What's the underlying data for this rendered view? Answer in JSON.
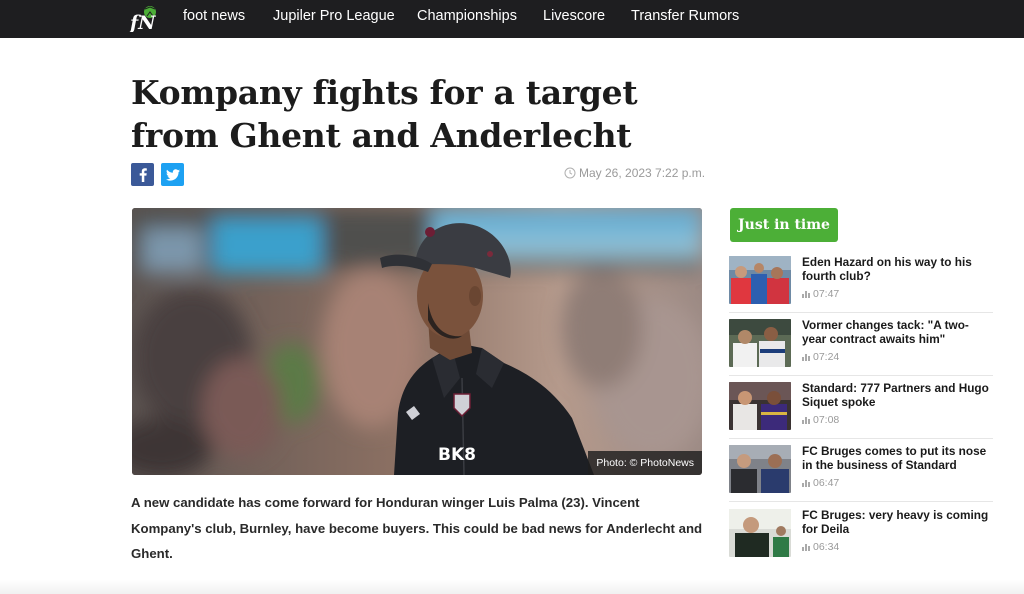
{
  "nav": {
    "logo_text": "fN",
    "items": [
      "foot news",
      "Jupiler Pro League",
      "Championships",
      "Livescore",
      "Transfer Rumors"
    ]
  },
  "article": {
    "headline": "Kompany fights for a target from Ghent and Anderlecht",
    "date": "May 26, 2023 7:22 p.m.",
    "photo_caption": "Photo: © PhotoNews",
    "lead": "A new candidate has come forward for Honduran winger Luis Palma (23). Vincent Kompany's club, Burnley, have become buyers. This could be bad news for Anderlecht and Ghent.",
    "shirt_sponsor": "BK8"
  },
  "share": {
    "facebook_icon": "facebook-icon",
    "twitter_icon": "twitter-icon"
  },
  "sidebar": {
    "heading": "Just in time",
    "items": [
      {
        "title": "Eden Hazard on his way to his fourth club?",
        "time": "07:47"
      },
      {
        "title": "Vormer changes tack: \"A two-year contract awaits him\"",
        "time": "07:24"
      },
      {
        "title": "Standard: 777 Partners and Hugo Siquet spoke",
        "time": "07:08"
      },
      {
        "title": "FC Bruges comes to put its nose in the business of Standard",
        "time": "06:47"
      },
      {
        "title": "FC Bruges: very heavy is coming for Deila",
        "time": "06:34"
      }
    ]
  },
  "colors": {
    "nav_bg": "#1e1e20",
    "accent_green": "#4caf37",
    "facebook": "#3b5998",
    "twitter": "#1da1f2"
  }
}
